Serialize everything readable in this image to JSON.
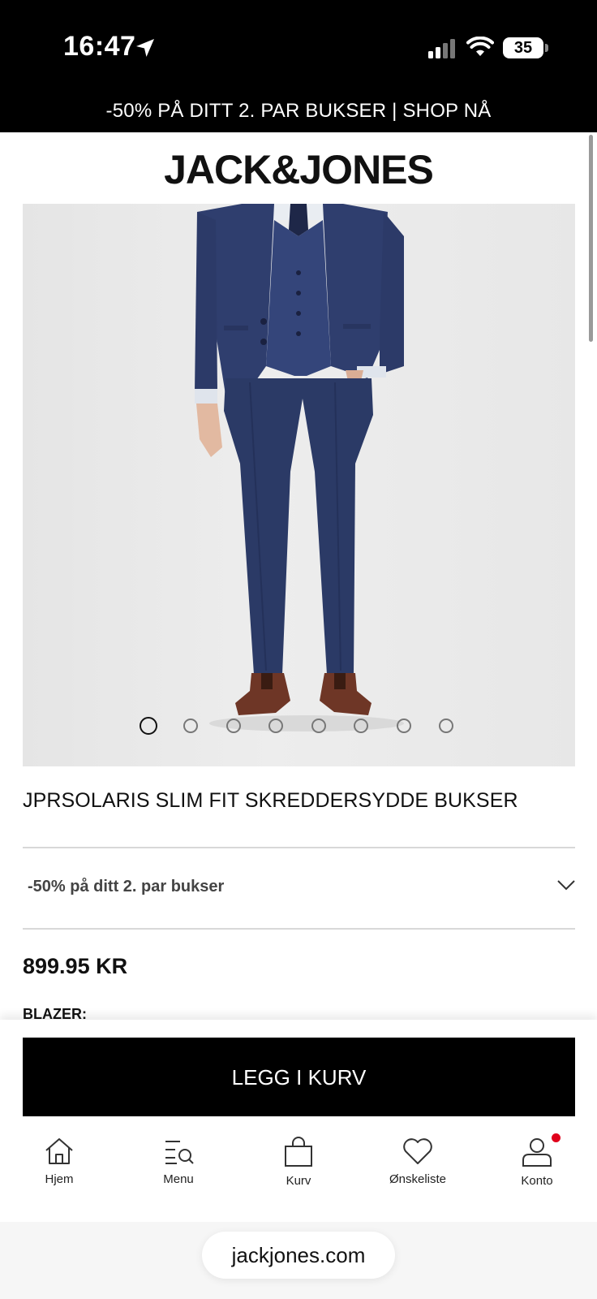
{
  "status_bar": {
    "time": "16:47",
    "battery": "35"
  },
  "promo_banner": "-50% PÅ DITT 2. PAR BUKSER | SHOP NÅ",
  "brand_logo": "JACK&JONES",
  "product": {
    "image_slide_count": 8,
    "image_active_slide": 1,
    "title": "JPRSOLARIS SLIM FIT SKREDDERSYDDE BUKSER",
    "offer_label": "-50% på ditt 2. par bukser",
    "price": "899.95 KR",
    "blazer_label": "BLAZER:"
  },
  "add_to_cart_label": "LEGG I KURV",
  "tabbar": {
    "items": [
      {
        "label": "Hjem",
        "icon": "home-icon"
      },
      {
        "label": "Menu",
        "icon": "menu-search-icon"
      },
      {
        "label": "Kurv",
        "icon": "bag-icon"
      },
      {
        "label": "Ønskeliste",
        "icon": "heart-icon"
      },
      {
        "label": "Konto",
        "icon": "account-icon"
      }
    ]
  },
  "browser": {
    "url": "jackjones.com"
  },
  "colors": {
    "banner_bg": "#000000",
    "accent_red": "#e0001b",
    "suit_navy": "#2b3a66"
  }
}
